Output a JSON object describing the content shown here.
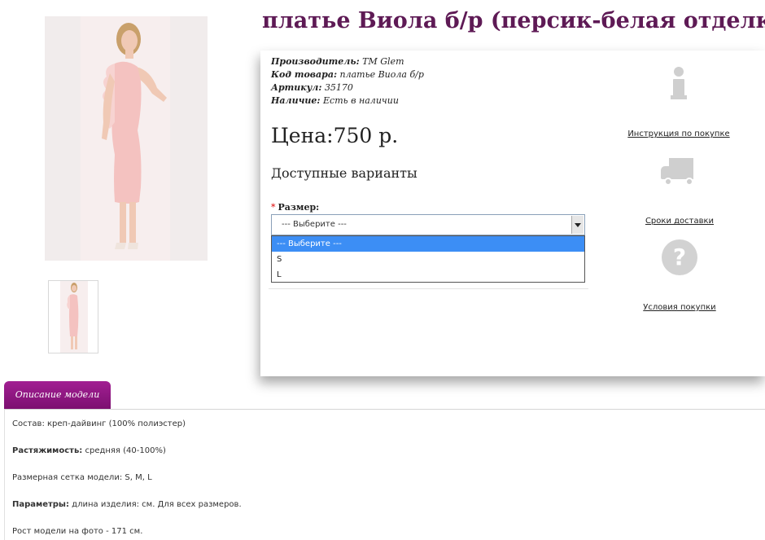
{
  "product": {
    "title": "платье Виола б/р (персик-белая отделка)",
    "meta": [
      {
        "label": "Производитель:",
        "value": "TM Glem"
      },
      {
        "label": "Код товара:",
        "value": "платье Виола б/р"
      },
      {
        "label": "Артикул:",
        "value": "35170"
      },
      {
        "label": "Наличие:",
        "value": "Есть в наличии"
      }
    ],
    "price": "Цена:750 р.",
    "variants_heading": "Доступные варианты"
  },
  "size": {
    "required_mark": "*",
    "label": "Размер:",
    "selected": "--- Выберите ---",
    "options": [
      "--- Выберите ---",
      "S",
      "L"
    ]
  },
  "side_links": {
    "instruction": "Инструкция по покупке",
    "delivery": "Сроки доставки",
    "conditions": "Условия покупки",
    "question_glyph": "?"
  },
  "tabs": {
    "description": "Описание модели"
  },
  "description": [
    {
      "label": "Состав:",
      "value": "креп-дайвинг (100% полиэстер)",
      "bold": false
    },
    {
      "label": "Растяжимость:",
      "value": "средняя (40-100%)",
      "bold": true
    },
    {
      "label": "Размерная сетка модели:",
      "value": "S, M, L",
      "bold": false
    },
    {
      "label": "Параметры:",
      "value": "длина изделия: см. Для всех размеров.",
      "bold": true
    },
    {
      "label": "Рост модели на фото -",
      "value": "171 см.",
      "bold": false
    }
  ],
  "colors": {
    "title": "#5e1a55",
    "accent": "#a21f93",
    "dress": "#f4c2c0",
    "skin": "#f0c9b5",
    "icon_gray": "#cfcfcf",
    "selected_option": "#3c8ef5"
  }
}
